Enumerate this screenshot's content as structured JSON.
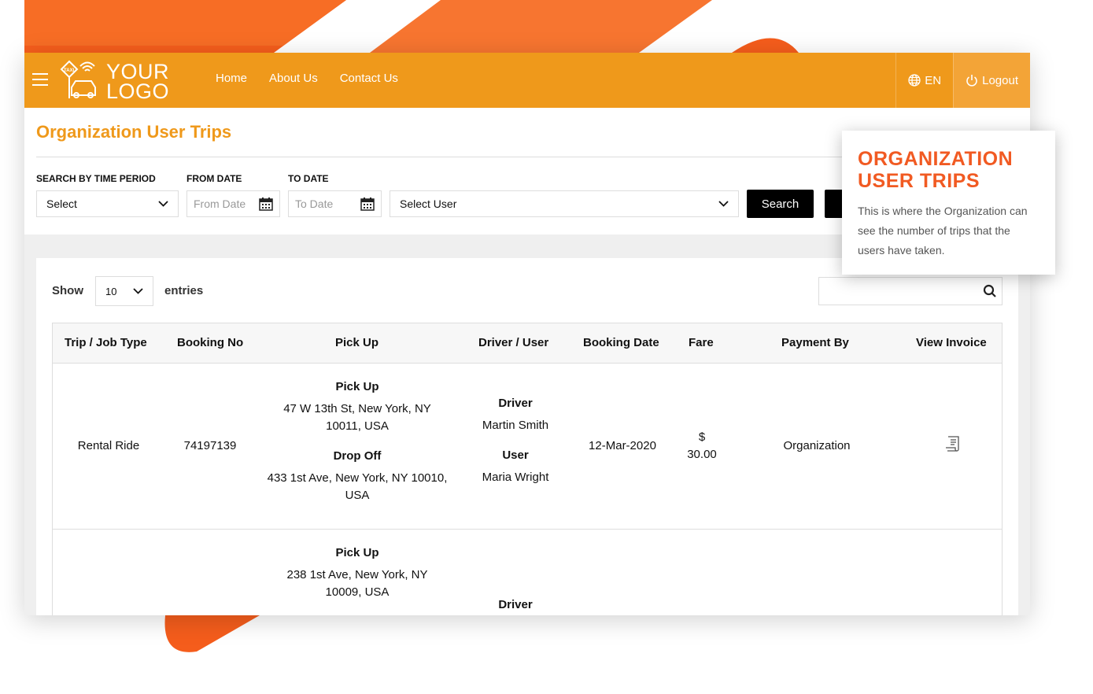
{
  "colors": {
    "brand": "#ef991b",
    "accent": "#f15a22",
    "black": "#000000"
  },
  "navbar": {
    "logo_line1": "YOUR",
    "logo_line2": "LOGO",
    "links": [
      "Home",
      "About Us",
      "Contact Us"
    ],
    "language": "EN",
    "logout": "Logout"
  },
  "page": {
    "title": "Organization User Trips"
  },
  "filters": {
    "time_period_label": "SEARCH BY TIME PERIOD",
    "time_period_value": "Select",
    "from_date_label": "FROM DATE",
    "from_date_placeholder": "From Date",
    "to_date_label": "TO DATE",
    "to_date_placeholder": "To Date",
    "user_value": "Select User",
    "search_button": "Search"
  },
  "table_controls": {
    "show_label": "Show",
    "entries_value": "10",
    "entries_label": "entries"
  },
  "table": {
    "headers": [
      "Trip / Job Type",
      "Booking No",
      "Pick Up",
      "Driver / User",
      "Booking Date",
      "Fare",
      "Payment By",
      "View Invoice"
    ],
    "rows": [
      {
        "trip_type": "Rental Ride",
        "booking_no": "74197139",
        "pickup_label": "Pick Up",
        "pickup_line1": "47 W 13th St, New York, NY",
        "pickup_line2": "10011, USA",
        "dropoff_label": "Drop Off",
        "dropoff_line1": "433 1st Ave, New York, NY 10010,",
        "dropoff_line2": "USA",
        "driver_label": "Driver",
        "driver_name": "Martin Smith",
        "user_label": "User",
        "user_name": "Maria Wright",
        "booking_date": "12-Mar-2020",
        "fare_currency": "$",
        "fare_amount": "30.00",
        "payment_by": "Organization",
        "invoice_icon": "invoice-icon"
      },
      {
        "pickup_label": "Pick Up",
        "pickup_line1": "238 1st Ave, New York, NY",
        "pickup_line2": "10009, USA",
        "driver_label": "Driver"
      }
    ]
  },
  "callout": {
    "title_line1": "ORGANIZATION",
    "title_line2": "USER TRIPS",
    "body": "This is where the Organization can see the number of trips that the users have taken."
  }
}
